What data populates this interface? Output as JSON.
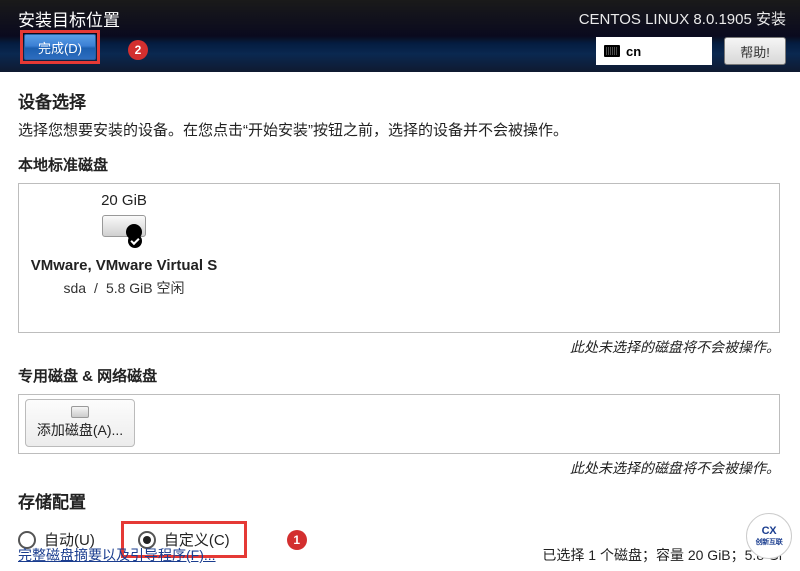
{
  "header": {
    "title": "安装目标位置",
    "done_label": "完成(D)",
    "subtitle": "CENTOS LINUX 8.0.1905 安装",
    "lang": "cn",
    "help_label": "帮助!"
  },
  "annotations": {
    "badge_done": "2",
    "badge_custom": "1"
  },
  "device": {
    "section_title": "设备选择",
    "desc": "选择您想要安装的设备。在您点击“开始安装”按钮之前，选择的设备并不会被操作。",
    "local_title": "本地标准磁盘",
    "disk": {
      "capacity": "20 GiB",
      "name": "VMware, VMware Virtual S",
      "dev": "sda",
      "free": "5.8 GiB 空闲"
    },
    "hints": {
      "unselected1": "此处未选择的磁盘将不会被操作。",
      "unselected2": "此处未选择的磁盘将不会被操作。"
    },
    "special_title": "专用磁盘 & 网络磁盘",
    "add_disk_label": "添加磁盘(A)..."
  },
  "storage": {
    "title": "存储配置",
    "auto_label": "自动(U)",
    "custom_label": "自定义(C)",
    "selected": "custom"
  },
  "footer": {
    "summary_link": "完整磁盘摘要以及引导程序(F)...",
    "selected_info": "已选择 1 个磁盘；容量 20 GiB；5.8 Gi"
  }
}
